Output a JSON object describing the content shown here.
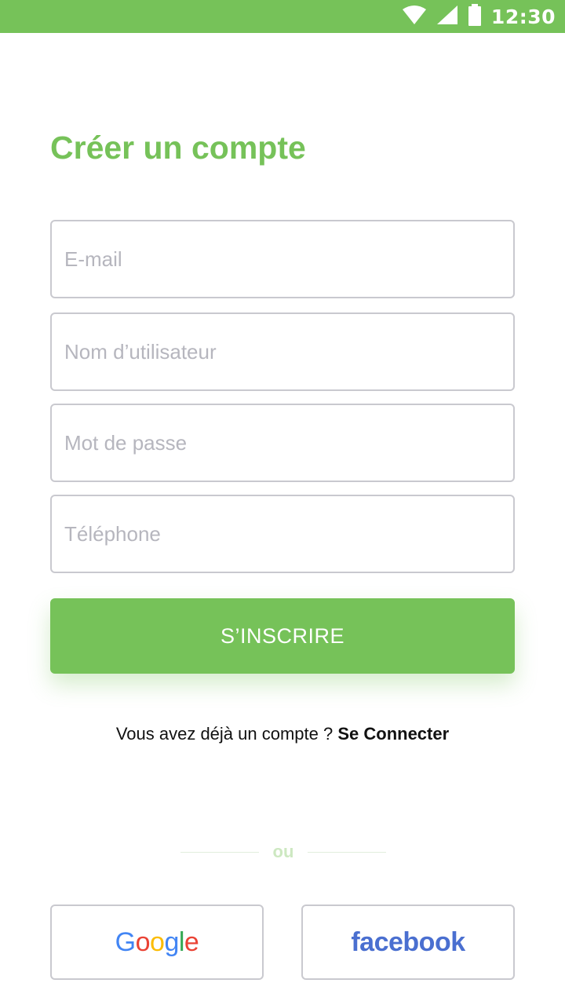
{
  "status_bar": {
    "time": "12:30",
    "icons": [
      "wifi-icon",
      "signal-icon",
      "battery-icon"
    ],
    "background": "#76c259"
  },
  "page": {
    "title": "Créer un compte"
  },
  "form": {
    "email": {
      "placeholder": "E-mail",
      "value": ""
    },
    "username": {
      "placeholder": "Nom d’utilisateur",
      "value": ""
    },
    "password": {
      "placeholder": "Mot de passe",
      "value": ""
    },
    "phone": {
      "placeholder": "Téléphone",
      "value": ""
    },
    "submit_label": "S’INSCRIRE"
  },
  "login": {
    "prompt": "Vous avez déjà un compte ? ",
    "link_label": "Se Connecter"
  },
  "separator": {
    "label": "ou"
  },
  "social": {
    "google_label": "Google",
    "facebook_label": "facebook"
  },
  "colors": {
    "accent": "#76c259",
    "google_blue": "#4285f4",
    "google_red": "#ea4335",
    "google_yellow": "#fbbc05",
    "google_green": "#34a853",
    "facebook_blue": "#4a6fd0"
  }
}
